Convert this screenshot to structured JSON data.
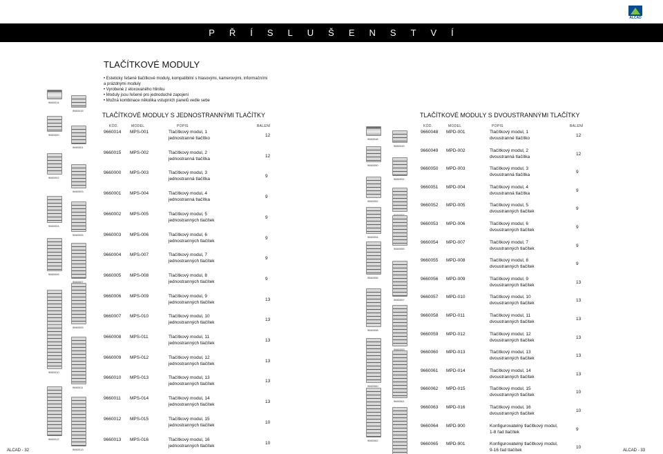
{
  "brand": "ALCAD",
  "header": "PŘÍSLUŠENSTVÍ",
  "main_title": "TLAČÍTKOVÉ MODULY",
  "bullets": [
    "Esteticky řešené tlačítkové moduly, kompatibilní s hlasovými, kamerovými, informačními a prázdnými moduly",
    "Vyrobené z eloxovaného hliníku",
    "Moduly jsou řešené pro jednoduché zapojení",
    "Možná kombinace několika vstupních panelů vedle sebe"
  ],
  "columns": {
    "kod": "KÓD.",
    "model": "MODEL",
    "popis": "POPIS",
    "baleni": "BALENÍ"
  },
  "left_section": {
    "title": "TLAČÍTKOVÉ MODULY S JEDNOSTRANNÝMI TLAČÍTKY",
    "rows": [
      {
        "code": "9660014",
        "model": "MPS-001",
        "d1": "Tlačítkový modul, 1",
        "d2": "jednostranné tlačítko",
        "pack": "12"
      },
      {
        "code": "9660015",
        "model": "MPS-002",
        "d1": "Tlačítkový modul, 2",
        "d2": "jednostranná tlačítka",
        "pack": "12"
      },
      {
        "code": "9660000",
        "model": "MPS-003",
        "d1": "Tlačítkový modul, 3",
        "d2": "jednostranná tlačítka",
        "pack": "9"
      },
      {
        "code": "9660001",
        "model": "MPS-004",
        "d1": "Tlačítkový modul, 4",
        "d2": "jednostranná tlačítka",
        "pack": "9"
      },
      {
        "code": "9660002",
        "model": "MPS-005",
        "d1": "Tlačítkový modul, 5",
        "d2": "jednostranných tlačítek",
        "pack": "9"
      },
      {
        "code": "9660003",
        "model": "MPS-006",
        "d1": "Tlačítkový modul, 6",
        "d2": "jednostranných tlačítek",
        "pack": "9"
      },
      {
        "code": "9660004",
        "model": "MPS-007",
        "d1": "Tlačítkový modul, 7",
        "d2": "jednostranných tlačítek",
        "pack": "9"
      },
      {
        "code": "9660005",
        "model": "MPS-008",
        "d1": "Tlačítkový modul, 8",
        "d2": "jednostranných tlačítek",
        "pack": "9"
      },
      {
        "code": "9660006",
        "model": "MPS-009",
        "d1": "Tlačítkový modul, 9",
        "d2": "jednostranných tlačítek",
        "pack": "13"
      },
      {
        "code": "9660007",
        "model": "MPS-010",
        "d1": "Tlačítkový modul, 10",
        "d2": "jednostranných tlačítek",
        "pack": "13"
      },
      {
        "code": "9660008",
        "model": "MPS-011",
        "d1": "Tlačítkový modul, 11",
        "d2": "jednostranných tlačítek",
        "pack": "13"
      },
      {
        "code": "9660009",
        "model": "MPS-012",
        "d1": "Tlačítkový modul, 12",
        "d2": "jednostranných tlačítek",
        "pack": "13"
      },
      {
        "code": "9660010",
        "model": "MPS-013",
        "d1": "Tlačítkový modul, 13",
        "d2": "jednostranných tlačítek",
        "pack": "13"
      },
      {
        "code": "9660011",
        "model": "MPS-014",
        "d1": "Tlačítkový modul, 14",
        "d2": "jednostranných tlačítek",
        "pack": "13"
      },
      {
        "code": "9660012",
        "model": "MPS-015",
        "d1": "Tlačítkový modul, 15",
        "d2": "jednostranných tlačítek",
        "pack": "10"
      },
      {
        "code": "9660013",
        "model": "MPS-016",
        "d1": "Tlačítkový modul, 16",
        "d2": "jednostranných tlačítek",
        "pack": "10"
      }
    ]
  },
  "right_section": {
    "title": "TLAČÍTKOVÉ MODULY S DVOUSTRANNÝMI TLAČÍTKY",
    "rows": [
      {
        "code": "9660048",
        "model": "MPD-001",
        "d1": "Tlačítkový modul, 1",
        "d2": "dvoustranné tlačítko",
        "pack": "12"
      },
      {
        "code": "9660049",
        "model": "MPD-002",
        "d1": "Tlačítkový modul, 2",
        "d2": "dvoustranná tlačítka",
        "pack": "12"
      },
      {
        "code": "9660050",
        "model": "MPD-003",
        "d1": "Tlačítkový modul, 3",
        "d2": "dvoustranná tlačítka",
        "pack": "9"
      },
      {
        "code": "9660051",
        "model": "MPD-004",
        "d1": "Tlačítkový modul, 4",
        "d2": "dvoustranná tlačítka",
        "pack": "9"
      },
      {
        "code": "9660052",
        "model": "MPD-005",
        "d1": "Tlačítkový modul, 5",
        "d2": "dvoustranných tlačítek",
        "pack": "9"
      },
      {
        "code": "9660053",
        "model": "MPD-006",
        "d1": "Tlačítkový modul, 6",
        "d2": "dvoustranných tlačítek",
        "pack": "9"
      },
      {
        "code": "9660054",
        "model": "MPD-007",
        "d1": "Tlačítkový modul, 7",
        "d2": "dvoustranných tlačítek",
        "pack": "9"
      },
      {
        "code": "9660055",
        "model": "MPD-008",
        "d1": "Tlačítkový modul, 8",
        "d2": "dvoustranných tlačítek",
        "pack": "9"
      },
      {
        "code": "9660056",
        "model": "MPD-009",
        "d1": "Tlačítkový modul, 9",
        "d2": "dvoustranných tlačítek",
        "pack": "13"
      },
      {
        "code": "9660057",
        "model": "MPD-010",
        "d1": "Tlačítkový modul, 10",
        "d2": "dvoustranných tlačítek",
        "pack": "13"
      },
      {
        "code": "9660058",
        "model": "MPD-011",
        "d1": "Tlačítkový modul, 11",
        "d2": "dvoustranných tlačítek",
        "pack": "13"
      },
      {
        "code": "9660059",
        "model": "MPD-012",
        "d1": "Tlačítkový modul, 12",
        "d2": "dvoustranných tlačítek",
        "pack": "13"
      },
      {
        "code": "9660060",
        "model": "MPD-013",
        "d1": "Tlačítkový modul, 13",
        "d2": "dvoustranných tlačítek",
        "pack": "13"
      },
      {
        "code": "9660061",
        "model": "MPD-014",
        "d1": "Tlačítkový modul, 14",
        "d2": "dvoustranných tlačítek",
        "pack": "13"
      },
      {
        "code": "9660062",
        "model": "MPD-015",
        "d1": "Tlačítkový modul, 15",
        "d2": "dvoustranných tlačítek",
        "pack": "10"
      },
      {
        "code": "9660063",
        "model": "MPD-016",
        "d1": "Tlačítkový modul, 16",
        "d2": "dvoustranných tlačítek",
        "pack": "10"
      },
      {
        "code": "9660064",
        "model": "MPD-900",
        "d1": "Konfigurovatelný tlačítkový modul,",
        "d2": "1-8 řad tlačítek",
        "pack": "9"
      },
      {
        "code": "9660065",
        "model": "MPD-901",
        "d1": "Konfigurovatelný tlačítkový modul,",
        "d2": "9-16 řad tlačítek",
        "pack": "10"
      }
    ]
  },
  "left_images": [
    {
      "label": "9660014",
      "kind": "top"
    },
    {
      "label": "9660015",
      "kind": "btn"
    },
    {
      "label": "9660000",
      "kind": "btn"
    },
    {
      "label": "9660001",
      "kind": "btn"
    },
    {
      "label": "9660002",
      "kind": "btn"
    },
    {
      "label": "9660003",
      "kind": "btn"
    },
    {
      "label": "9660004",
      "kind": "btn"
    },
    {
      "label": "9660005",
      "kind": "btn"
    },
    {
      "label": "9660006",
      "kind": "btn"
    },
    {
      "label": "9660007",
      "kind": "btn"
    },
    {
      "label": "9660008",
      "kind": "btn"
    },
    {
      "label": "9660009",
      "kind": "btn"
    },
    {
      "label": "9660010",
      "kind": "btn"
    },
    {
      "label": "9660011",
      "kind": "btn"
    },
    {
      "label": "9660012",
      "kind": "btn"
    },
    {
      "label": "9660013",
      "kind": "btn"
    }
  ],
  "right_images": [
    {
      "label": "9660048",
      "kind": "top"
    },
    {
      "label": "9660049",
      "kind": "btn"
    },
    {
      "label": "9660050",
      "kind": "btn"
    },
    {
      "label": "9660051",
      "kind": "btn"
    },
    {
      "label": "9660052",
      "kind": "btn"
    },
    {
      "label": "9660053",
      "kind": "btn"
    },
    {
      "label": "9660054",
      "kind": "btn"
    },
    {
      "label": "9660055",
      "kind": "btn"
    },
    {
      "label": "9660056",
      "kind": "btn"
    },
    {
      "label": "9660057",
      "kind": "btn"
    },
    {
      "label": "9660058",
      "kind": "btn"
    },
    {
      "label": "9660059",
      "kind": "btn"
    },
    {
      "label": "9660060",
      "kind": "btn"
    },
    {
      "label": "9660061",
      "kind": "btn"
    },
    {
      "label": "9660062",
      "kind": "btn"
    },
    {
      "label": "9660063",
      "kind": "btn"
    }
  ],
  "page_left": "ALCAD - 32",
  "page_right": "ALCAD - 33"
}
